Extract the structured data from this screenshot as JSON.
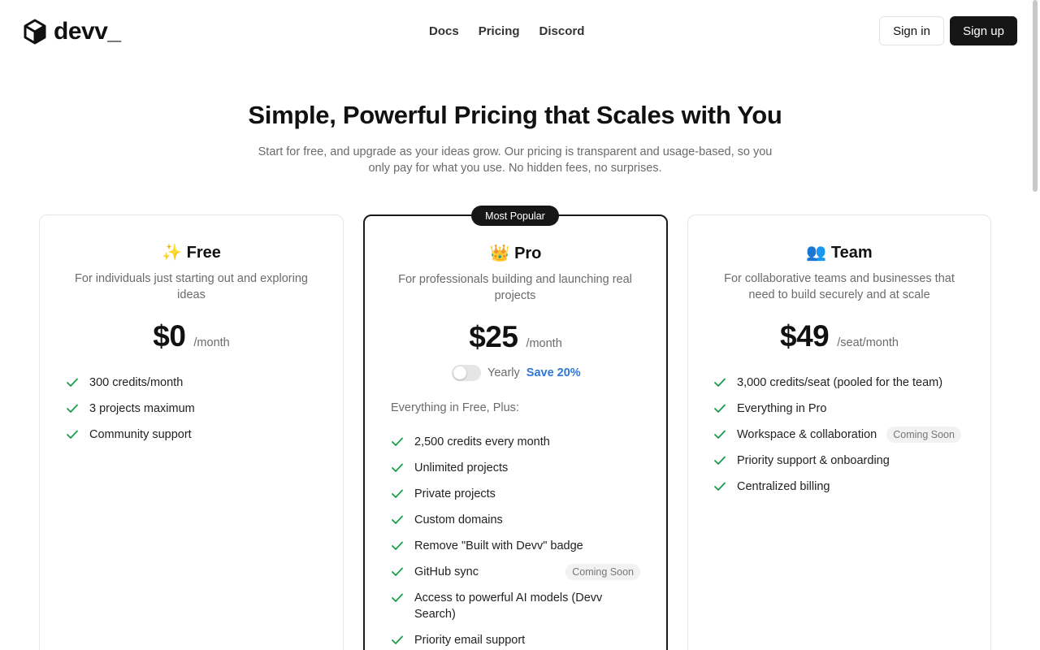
{
  "header": {
    "logo_text": "devv_",
    "nav": [
      "Docs",
      "Pricing",
      "Discord"
    ],
    "sign_in": "Sign in",
    "sign_up": "Sign up"
  },
  "hero": {
    "title": "Simple, Powerful Pricing that Scales with You",
    "subtitle": "Start for free, and upgrade as your ideas grow. Our pricing is transparent and usage-based, so you only pay for what you use. No hidden fees, no surprises."
  },
  "plans": {
    "free": {
      "emoji": "✨",
      "name": "Free",
      "description": "For individuals just starting out and exploring ideas",
      "price": "$0",
      "period": "/month",
      "features": [
        "300 credits/month",
        "3 projects maximum",
        "Community support"
      ]
    },
    "pro": {
      "badge": "Most Popular",
      "emoji": "👑",
      "name": "Pro",
      "description": "For professionals building and launching real projects",
      "price": "$25",
      "period": "/month",
      "toggle_label": "Yearly",
      "toggle_save": "Save 20%",
      "toggle_on": false,
      "intro": "Everything in Free, Plus:",
      "features": [
        "2,500 credits every month",
        "Unlimited projects",
        "Private projects",
        "Custom domains",
        "Remove \"Built with Devv\" badge",
        "GitHub sync",
        "Access to powerful AI models (Devv Search)",
        "Priority email support"
      ],
      "github_badge": "Coming Soon"
    },
    "team": {
      "emoji": "👥",
      "name": "Team",
      "description": "For collaborative teams and businesses that need to build securely and at scale",
      "price": "$49",
      "period": "/seat/month",
      "features": [
        "3,000 credits/seat (pooled for the team)",
        "Everything in Pro",
        "Workspace & collaboration",
        "Priority support & onboarding",
        "Centralized billing"
      ],
      "workspace_badge": "Coming Soon"
    }
  },
  "colors": {
    "check": "#1a9e4b",
    "accent_blue": "#2f76d6",
    "dark": "#161616"
  }
}
